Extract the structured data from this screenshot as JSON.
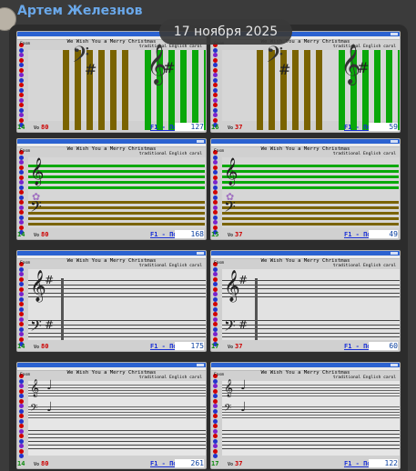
{
  "chat": {
    "sender_name": "Артем Железнов",
    "date_label": "17 ноября 2025"
  },
  "colors": {
    "sender": "#6aa8ea",
    "brown_bar": "#7a6300",
    "green_bar": "#0aa80a",
    "counter": "#0a8a0a",
    "volume": "#cc0000",
    "hint": "#1a30d6"
  },
  "screenshots": [
    {
      "song_title": "We Wish You a Merry Christmas",
      "source": "traditional English carol",
      "mode_label": "Fasm",
      "counter": "14",
      "volume_prefix": "Vo",
      "volume": "80",
      "hint": "F1 - Помощь",
      "tick": "127",
      "clefs": [
        "treble-clef-icon",
        "bass-clef-icon"
      ],
      "sharp": "#",
      "view": "bars"
    },
    {
      "song_title": "We Wish You a Merry Christmas",
      "source": "traditional English carol",
      "mode_label": "Fasm",
      "counter": "16",
      "volume_prefix": "Vo",
      "volume": "37",
      "hint": "F1 - Помощь",
      "tick": "59",
      "clefs": [
        "treble-clef-icon",
        "bass-clef-icon"
      ],
      "sharp": "#",
      "view": "bars"
    },
    {
      "song_title": "We Wish You a Merry Christmas",
      "source": "traditional English carol",
      "mode_label": "Fasm",
      "counter": "14",
      "volume_prefix": "Vo",
      "volume": "80",
      "hint": "F1 - Помощь",
      "tick": "168",
      "clefs": [
        "treble-clef-icon",
        "bass-clef-icon"
      ],
      "sharp": "#",
      "view": "lanes"
    },
    {
      "song_title": "We Wish You a Merry Christmas",
      "source": "traditional English carol",
      "mode_label": "Fasm",
      "counter": "15",
      "volume_prefix": "Vo",
      "volume": "37",
      "hint": "F1 - Помощь",
      "tick": "49",
      "clefs": [
        "treble-clef-icon",
        "bass-clef-icon"
      ],
      "sharp": "#",
      "view": "lanes"
    },
    {
      "song_title": "We Wish You a Merry Christmas",
      "source": "traditional English carol",
      "mode_label": "Fasm",
      "counter": "14",
      "volume_prefix": "Vo",
      "volume": "80",
      "hint": "F1 - Помощь",
      "tick": "175",
      "clefs": [
        "treble-clef-icon",
        "bass-clef-icon"
      ],
      "sharp": "#",
      "view": "staff"
    },
    {
      "song_title": "We Wish You a Merry Christmas",
      "source": "traditional English carol",
      "mode_label": "Fasm",
      "counter": "17",
      "volume_prefix": "Vo",
      "volume": "37",
      "hint": "F1 - Помощь",
      "tick": "60",
      "clefs": [
        "treble-clef-icon",
        "bass-clef-icon"
      ],
      "sharp": "#",
      "view": "staff"
    },
    {
      "song_title": "We Wish You a Merry Christmas",
      "source": "traditional English carol",
      "mode_label": "Fasm",
      "counter": "14",
      "volume_prefix": "Vo",
      "volume": "80",
      "hint": "F1 - Помощь",
      "tick": "261",
      "clefs": [
        "treble-clef-icon",
        "bass-clef-icon"
      ],
      "sharp": "#",
      "view": "small"
    },
    {
      "song_title": "We Wish You a Merry Christmas",
      "source": "traditional English carol",
      "mode_label": "Fasm",
      "counter": "17",
      "volume_prefix": "Vo",
      "volume": "37",
      "hint": "F1 - Помощь",
      "tick": "122",
      "clefs": [
        "treble-clef-icon",
        "bass-clef-icon"
      ],
      "sharp": "#",
      "view": "small"
    }
  ]
}
